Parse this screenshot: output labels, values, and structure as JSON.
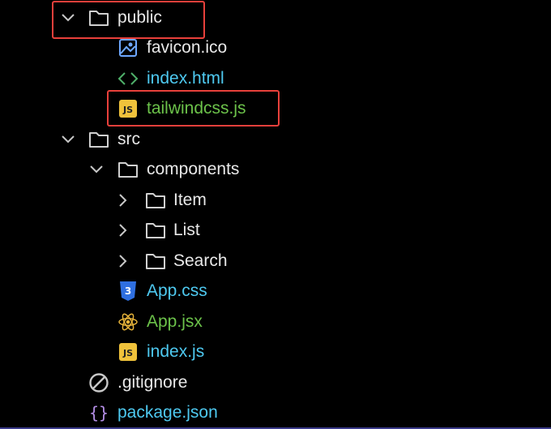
{
  "tree": {
    "public": {
      "name": "public",
      "icon": "folder-icon",
      "expanded": true
    },
    "favicon": {
      "name": "favicon.ico",
      "icon": "image-file-icon"
    },
    "index_html": {
      "name": "index.html",
      "icon": "html-code-icon"
    },
    "tailwind": {
      "name": "tailwindcss.js",
      "icon": "js-file-icon"
    },
    "src": {
      "name": "src",
      "icon": "folder-icon",
      "expanded": true
    },
    "components": {
      "name": "components",
      "icon": "folder-icon",
      "expanded": true
    },
    "item": {
      "name": "Item",
      "icon": "folder-icon",
      "expanded": false
    },
    "list": {
      "name": "List",
      "icon": "folder-icon",
      "expanded": false
    },
    "search": {
      "name": "Search",
      "icon": "folder-icon",
      "expanded": false
    },
    "app_css": {
      "name": "App.css",
      "icon": "css-file-icon"
    },
    "app_jsx": {
      "name": "App.jsx",
      "icon": "react-icon"
    },
    "index_js": {
      "name": "index.js",
      "icon": "js-file-icon"
    },
    "gitignore": {
      "name": ".gitignore",
      "icon": "gitignore-icon"
    },
    "package_json": {
      "name": "package.json",
      "icon": "json-braces-icon"
    }
  },
  "colors": {
    "background": "#000000",
    "folder_text": "#e8e8e8",
    "cyan_text": "#4ec9f0",
    "green_text": "#6cc24a",
    "highlight": "#e8403b",
    "js_badge": "#f0c23b",
    "css_badge": "#2f6fe0",
    "react": "#e6b33a",
    "json": "#b48ee6"
  },
  "highlights": [
    "public",
    "tailwindcss.js"
  ]
}
